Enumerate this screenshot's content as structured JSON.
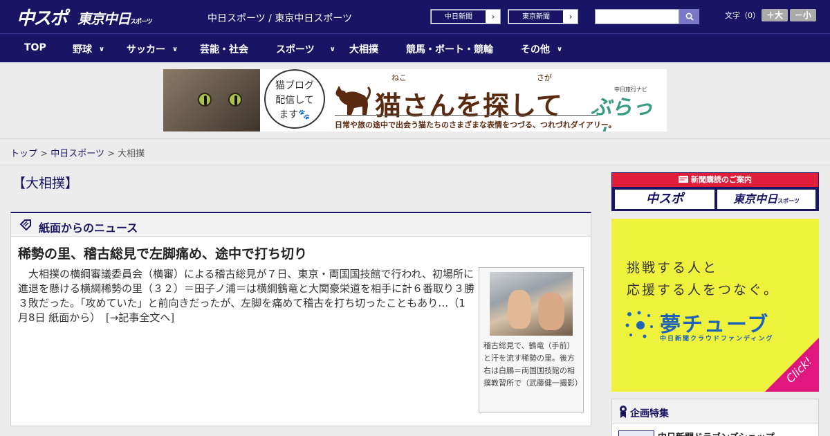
{
  "header": {
    "logo_chuspo": "中スポ",
    "logo_tokyo": "東京中日",
    "logo_tokyo_small": "スポーツ",
    "site_links": "中日スポーツ / 東京中日スポーツ",
    "ext_links": [
      {
        "label": "中日新聞",
        "arrow": "›"
      },
      {
        "label": "東京新聞",
        "arrow": "›"
      }
    ],
    "search": {
      "value": "",
      "placeholder": ""
    },
    "font_size": {
      "label": "文字（0）",
      "larger": "＋大",
      "smaller": "－小"
    }
  },
  "nav": {
    "items": [
      {
        "label": "TOP",
        "has_dropdown": false
      },
      {
        "label": "野球",
        "has_dropdown": true
      },
      {
        "label": "サッカー",
        "has_dropdown": true
      },
      {
        "label": "芸能・社会",
        "has_dropdown": false
      },
      {
        "label": "スポーツ",
        "has_dropdown": true
      },
      {
        "label": "大相撲",
        "has_dropdown": false
      },
      {
        "label": "競馬・ボート・競輪",
        "has_dropdown": false
      },
      {
        "label": "その他",
        "has_dropdown": true
      }
    ],
    "chevron": "∨"
  },
  "banner": {
    "bubble_line1": "猫ブログ",
    "bubble_line2": "配信して",
    "bubble_line3": "ます🐾",
    "ruby_neko": "ねこ",
    "ruby_saga": "さが",
    "title": "猫さんを探して",
    "brand_small": "中日旅行ナビ",
    "brand": "ぶらっ人",
    "subtitle": "日常や旅の途中で出会う猫たちのさまざまな表情をつづる、つれづれダイアリー。"
  },
  "breadcrumb": {
    "top": "トップ",
    "sep": ">",
    "parent": "中日スポーツ",
    "current": "大相撲"
  },
  "section_title": "【大相撲】",
  "news": {
    "panel_title": "紙面からのニュース",
    "headline": "稀勢の里、稽古総見で左脚痛め、途中で打ち切り",
    "lede": "大相撲の横綱審議委員会（横審）による稽古総見が７日、東京・両国国技館で行われ、初場所に進退を懸ける横綱稀勢の里（３２）＝田子ノ浦＝は横綱鶴竜と大関豪栄道を相手に計６番取り３勝３敗だった。「攻めていた」と前向きだったが、左脚を痛めて稽古を打ち切ったこともあり…（1月8日 紙面から）",
    "more_link": "[→記事全文へ]",
    "caption": "稽古総見で、鶴竜（手前）と汗を流す稀勢の里。後方右は白鵬＝両国国技館の相撲教習所で（武藤健一撮影）"
  },
  "sidebar": {
    "subscribe_title": "新聞購読のご案内",
    "subscribe_buttons": [
      "中スポ",
      "東京中日"
    ],
    "subscribe_small": "スポーツ",
    "ad_line1": "挑戦する人と",
    "ad_line2": "応援する人をつなぐ。",
    "ad_logo": "夢チューブ",
    "ad_sub": "中日新聞クラウドファンディング",
    "ad_click": "Click!",
    "feature_title": "企画特集",
    "feature_item": "中日新聞ドラゴンズショップ"
  },
  "colors": {
    "brand_navy": "#1a1464",
    "subscribe_red": "#e01d3a",
    "ad_yellow": "#eef23c",
    "ad_blue": "#1f63b8",
    "ad_pink": "#e0177d"
  },
  "icons": [
    "search-icon",
    "chevron-right-icon",
    "chevron-down-icon",
    "news-tag-icon",
    "ribbon-icon",
    "newspaper-icon"
  ]
}
